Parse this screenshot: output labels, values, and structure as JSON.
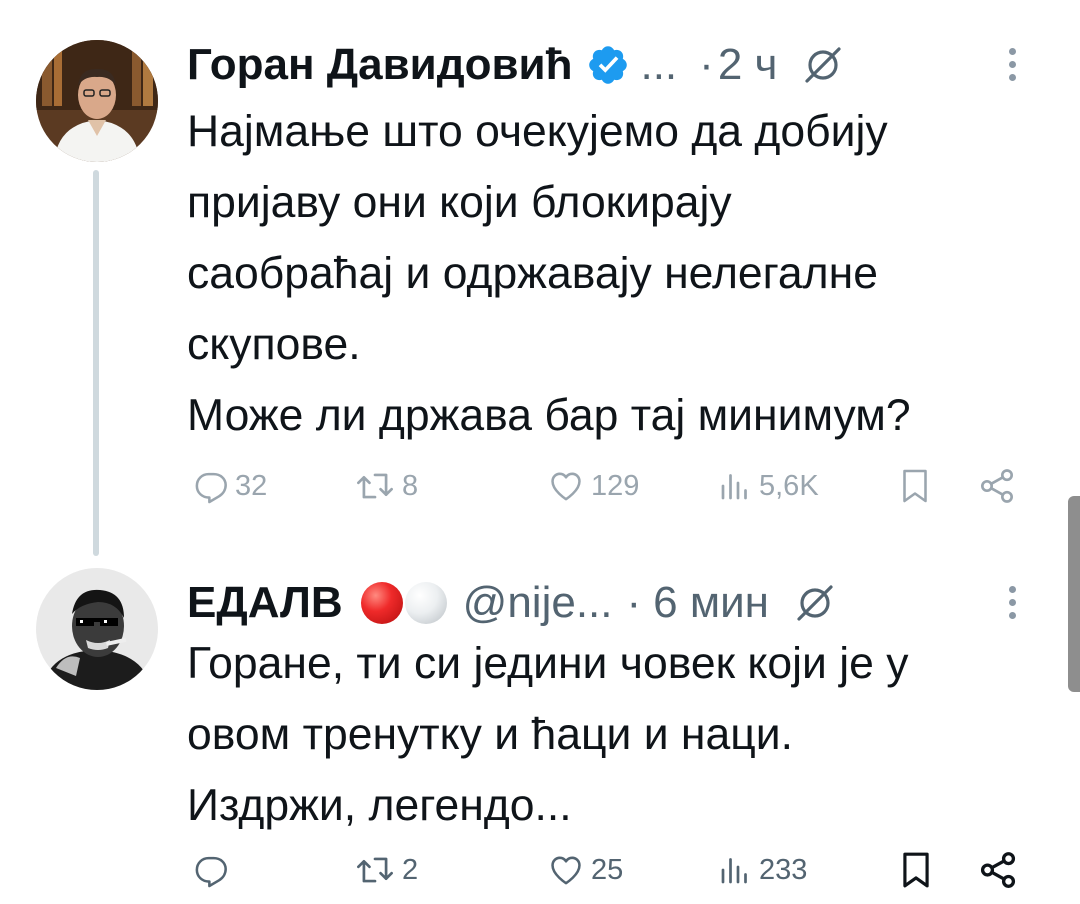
{
  "tweets": [
    {
      "author_name": "Горан Давидовић",
      "handle": "...",
      "separator": "·",
      "time": "2 ч",
      "verified": true,
      "text_lines": [
        "Најмање што очекујемо да добију",
        "пријаву они који блокирају",
        "саобраћај и одржавају нелегалне",
        "скупове.",
        "Може ли држава бар тај минимум?"
      ],
      "actions": {
        "replies": "32",
        "reposts": "8",
        "likes": "129",
        "views": "5,6K"
      }
    },
    {
      "author_name": "ЕДАЛВ",
      "handle": "@nije...",
      "separator": "·",
      "time": "6 мин",
      "flags": [
        "red-circle",
        "white-circle"
      ],
      "text_lines": [
        "Горане, ти си једини човек који је у",
        "овом тренутку и ћаци и наци.",
        "Издржи, легендо..."
      ],
      "actions": {
        "replies": "",
        "reposts": "2",
        "likes": "25",
        "views": "233"
      }
    }
  ],
  "colors": {
    "text": "#0f1419",
    "muted": "#536471",
    "verified": "#1d9bf0",
    "thread_line": "#cfd9de"
  }
}
